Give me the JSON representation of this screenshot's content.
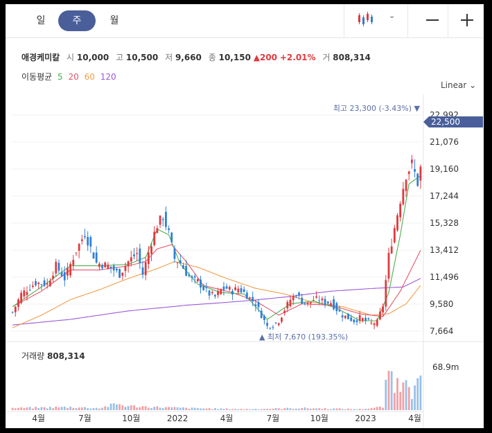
{
  "toolbar": {
    "tabs": [
      {
        "label": "일",
        "active": false
      },
      {
        "label": "주",
        "active": true
      },
      {
        "label": "월",
        "active": false
      }
    ],
    "chart_type_icon": "candlestick-icon",
    "zoom_out_icon": "minus-icon",
    "zoom_in_icon": "plus-icon"
  },
  "quote": {
    "name": "애경케미칼",
    "open_label": "시",
    "open": "10,000",
    "high_label": "고",
    "high": "10,500",
    "low_label": "저",
    "low": "9,660",
    "close_label": "종",
    "close": "10,150",
    "change": "▲200",
    "change_pct": "+2.01%",
    "volume_label": "거",
    "volume": "808,314"
  },
  "ma_legend": {
    "label": "이동평균",
    "periods": [
      {
        "value": "5",
        "color": "#4caf50"
      },
      {
        "value": "20",
        "color": "#e5546b"
      },
      {
        "value": "60",
        "color": "#f29d49"
      },
      {
        "value": "120",
        "color": "#9b59d6"
      }
    ]
  },
  "scale": {
    "label": "Linear"
  },
  "colors": {
    "up": "#e0393e",
    "down": "#2f7fd3",
    "current_tag": "#4a5f9a",
    "annotation": "#5a6fa8"
  },
  "chart_data": {
    "type": "candlestick",
    "price_axis": {
      "ticks": [
        "22,992",
        "21,076",
        "19,160",
        "17,244",
        "15,328",
        "13,412",
        "11,496",
        "9,580",
        "7,664"
      ],
      "min": 7664,
      "max": 22992
    },
    "current_price": {
      "label": "22,500",
      "value": 22500
    },
    "annotations": {
      "high": {
        "label": "최고",
        "value": "23,300 (-3.43%)",
        "arrow": "▼"
      },
      "low": {
        "label": "최저",
        "value": "7,670 (193.35%)",
        "arrow": "▲"
      }
    },
    "x_ticks": [
      "4월",
      "7월",
      "10월",
      "2022",
      "4월",
      "7월",
      "10월",
      "2023",
      "4월"
    ],
    "volume": {
      "title": "거래량",
      "value": "808,314",
      "axis_label": "68.9m"
    },
    "close_path": [
      [
        0,
        9000
      ],
      [
        3,
        10300
      ],
      [
        8,
        11100
      ],
      [
        12,
        11000
      ],
      [
        15,
        12300
      ],
      [
        18,
        11400
      ],
      [
        22,
        13400
      ],
      [
        25,
        14600
      ],
      [
        29,
        12500
      ],
      [
        33,
        12300
      ],
      [
        37,
        11700
      ],
      [
        40,
        12600
      ],
      [
        43,
        13200
      ],
      [
        45,
        11700
      ],
      [
        48,
        14000
      ],
      [
        50,
        15200
      ],
      [
        52,
        15800
      ],
      [
        54,
        14600
      ],
      [
        56,
        12800
      ],
      [
        58,
        12500
      ],
      [
        60,
        11800
      ],
      [
        62,
        11300
      ],
      [
        64,
        11200
      ],
      [
        66,
        10700
      ],
      [
        68,
        10300
      ],
      [
        70,
        10100
      ],
      [
        72,
        10600
      ],
      [
        74,
        10700
      ],
      [
        76,
        10500
      ],
      [
        78,
        10700
      ],
      [
        80,
        10400
      ],
      [
        82,
        10000
      ],
      [
        84,
        9600
      ],
      [
        86,
        8800
      ],
      [
        88,
        8000
      ],
      [
        90,
        8100
      ],
      [
        92,
        8400
      ],
      [
        94,
        9200
      ],
      [
        96,
        9900
      ],
      [
        98,
        10300
      ],
      [
        100,
        9800
      ],
      [
        102,
        9600
      ],
      [
        104,
        9900
      ],
      [
        106,
        9900
      ],
      [
        108,
        9700
      ],
      [
        110,
        9700
      ],
      [
        112,
        9200
      ],
      [
        114,
        8800
      ],
      [
        116,
        8600
      ],
      [
        118,
        8400
      ],
      [
        120,
        8600
      ],
      [
        122,
        8400
      ],
      [
        124,
        8200
      ],
      [
        126,
        8300
      ],
      [
        128,
        9500
      ],
      [
        130,
        13000
      ],
      [
        132,
        15000
      ],
      [
        134,
        17000
      ],
      [
        136,
        18800
      ],
      [
        138,
        19500
      ],
      [
        140,
        18200
      ],
      [
        141,
        19200
      ]
    ],
    "ma5_path": [
      [
        0,
        9400
      ],
      [
        10,
        10800
      ],
      [
        20,
        12300
      ],
      [
        30,
        12300
      ],
      [
        40,
        12400
      ],
      [
        46,
        12900
      ],
      [
        50,
        14900
      ],
      [
        54,
        14500
      ],
      [
        58,
        12400
      ],
      [
        64,
        11000
      ],
      [
        72,
        10400
      ],
      [
        80,
        10300
      ],
      [
        88,
        8500
      ],
      [
        96,
        9600
      ],
      [
        104,
        9800
      ],
      [
        112,
        9300
      ],
      [
        120,
        8400
      ],
      [
        126,
        8400
      ],
      [
        130,
        10400
      ],
      [
        134,
        14500
      ],
      [
        137,
        18100
      ],
      [
        141,
        18700
      ]
    ],
    "ma20_path": [
      [
        0,
        9400
      ],
      [
        10,
        10500
      ],
      [
        20,
        12000
      ],
      [
        30,
        12000
      ],
      [
        40,
        12300
      ],
      [
        46,
        12600
      ],
      [
        50,
        13500
      ],
      [
        55,
        13800
      ],
      [
        60,
        12600
      ],
      [
        66,
        10900
      ],
      [
        76,
        10400
      ],
      [
        84,
        9800
      ],
      [
        92,
        8800
      ],
      [
        100,
        9600
      ],
      [
        110,
        9500
      ],
      [
        120,
        8900
      ],
      [
        128,
        8700
      ],
      [
        134,
        10500
      ],
      [
        141,
        13400
      ]
    ],
    "ma60_path": [
      [
        0,
        7900
      ],
      [
        10,
        8800
      ],
      [
        20,
        9900
      ],
      [
        30,
        10600
      ],
      [
        40,
        11400
      ],
      [
        50,
        12100
      ],
      [
        56,
        12600
      ],
      [
        64,
        12200
      ],
      [
        74,
        11400
      ],
      [
        84,
        10700
      ],
      [
        94,
        10300
      ],
      [
        104,
        9700
      ],
      [
        114,
        9400
      ],
      [
        124,
        8800
      ],
      [
        130,
        8900
      ],
      [
        136,
        9600
      ],
      [
        141,
        10900
      ]
    ],
    "ma120_path": [
      [
        0,
        8100
      ],
      [
        20,
        8500
      ],
      [
        40,
        9100
      ],
      [
        60,
        9500
      ],
      [
        80,
        9800
      ],
      [
        95,
        10100
      ],
      [
        110,
        10500
      ],
      [
        125,
        10700
      ],
      [
        135,
        10800
      ],
      [
        141,
        11400
      ]
    ],
    "volume_path": [
      [
        0,
        2
      ],
      [
        20,
        3
      ],
      [
        30,
        2
      ],
      [
        36,
        6
      ],
      [
        40,
        4
      ],
      [
        60,
        2
      ],
      [
        80,
        1
      ],
      [
        100,
        2
      ],
      [
        120,
        1
      ],
      [
        128,
        3
      ],
      [
        130,
        40
      ],
      [
        132,
        28
      ],
      [
        134,
        24
      ],
      [
        136,
        45
      ],
      [
        138,
        18
      ],
      [
        140,
        24
      ],
      [
        141,
        30
      ]
    ]
  }
}
